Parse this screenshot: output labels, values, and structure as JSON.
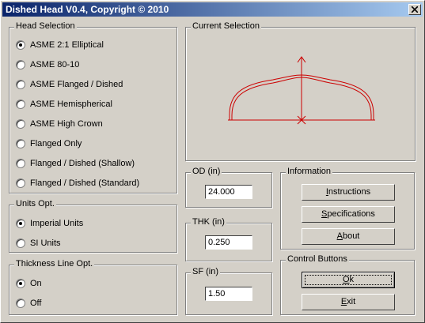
{
  "window": {
    "title": "Dished Head V0.4, Copyright © 2010",
    "close_icon": "close-icon"
  },
  "head_selection": {
    "label": "Head Selection",
    "options": [
      {
        "label": "ASME 2:1 Elliptical",
        "selected": true
      },
      {
        "label": "ASME 80-10",
        "selected": false
      },
      {
        "label": "ASME Flanged / Dished",
        "selected": false
      },
      {
        "label": "ASME Hemispherical",
        "selected": false
      },
      {
        "label": "ASME High Crown",
        "selected": false
      },
      {
        "label": "Flanged Only",
        "selected": false
      },
      {
        "label": "Flanged / Dished (Shallow)",
        "selected": false
      },
      {
        "label": "Flanged / Dished (Standard)",
        "selected": false
      }
    ]
  },
  "units": {
    "label": "Units Opt.",
    "options": [
      {
        "label": "Imperial Units",
        "selected": true
      },
      {
        "label": "SI Units",
        "selected": false
      }
    ]
  },
  "thickness_line": {
    "label": "Thickness Line Opt.",
    "options": [
      {
        "label": "On",
        "selected": true
      },
      {
        "label": "Off",
        "selected": false
      }
    ]
  },
  "current_selection": {
    "label": "Current Selection",
    "drawing_color": "#cc0000"
  },
  "od": {
    "label": "OD (in)",
    "value": "24.000"
  },
  "thk": {
    "label": "THK (in)",
    "value": "0.250"
  },
  "sf": {
    "label": "SF (in)",
    "value": "1.50"
  },
  "information": {
    "label": "Information",
    "buttons": [
      {
        "mnemonic": "I",
        "rest": "nstructions"
      },
      {
        "mnemonic": "S",
        "rest": "pecifications"
      },
      {
        "mnemonic": "A",
        "rest": "bout"
      }
    ]
  },
  "control_buttons": {
    "label": "Control Buttons",
    "ok": {
      "mnemonic": "O",
      "rest": "k"
    },
    "exit": {
      "mnemonic": "E",
      "rest": "xit"
    }
  }
}
